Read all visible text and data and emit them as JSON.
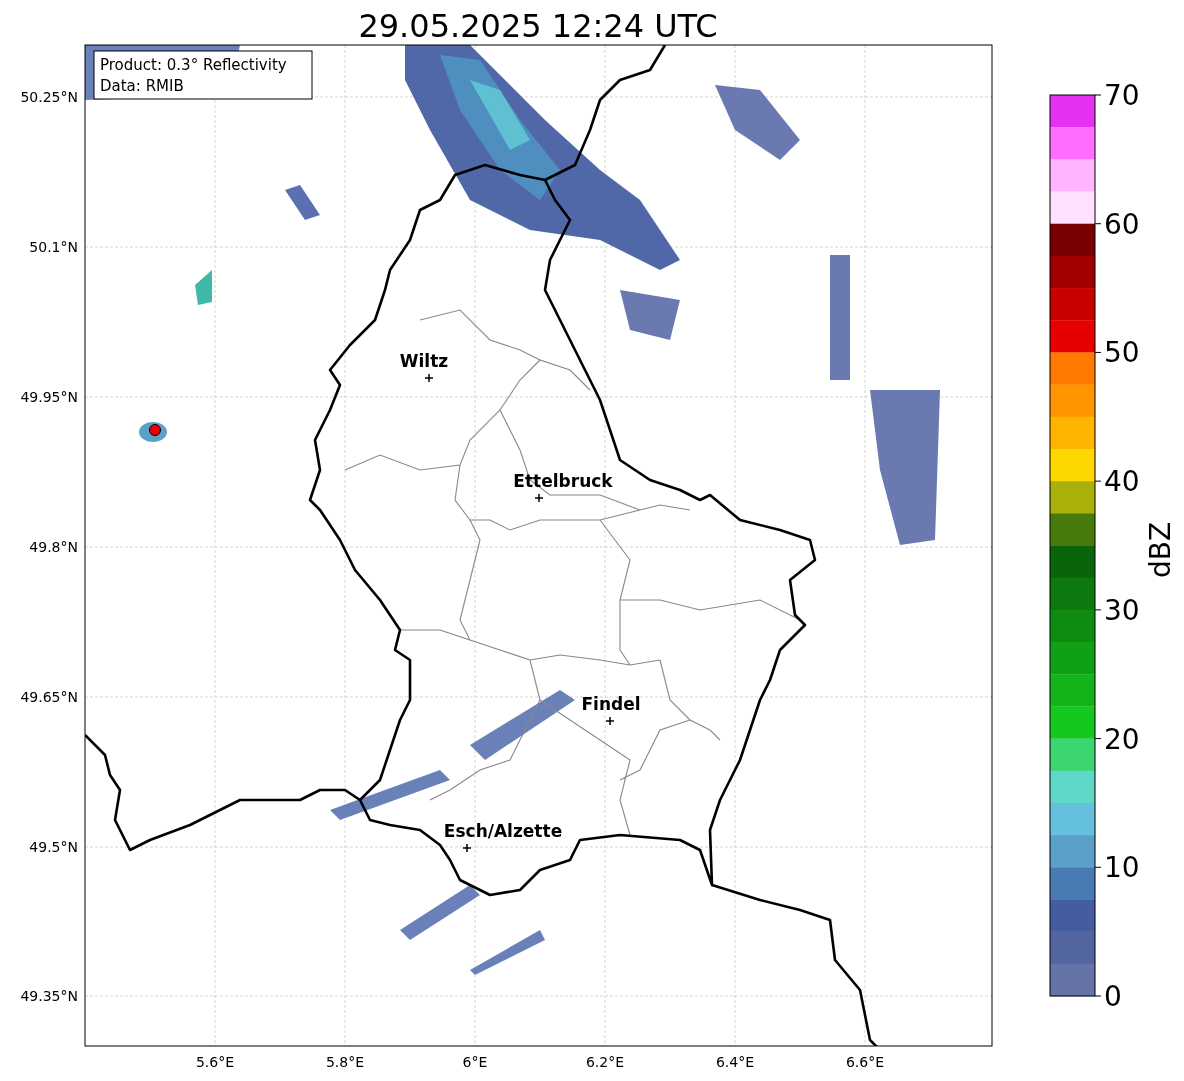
{
  "title": "29.05.2025 12:24 UTC",
  "info": [
    "Product: 0.3° Reflectivity",
    "Data: RMIB"
  ],
  "map": {
    "x_ticks": [
      "5.6°E",
      "5.8°E",
      "6°E",
      "6.2°E",
      "6.4°E",
      "6.6°E"
    ],
    "y_ticks": [
      "50.25°N",
      "50.1°N",
      "49.95°N",
      "49.8°N",
      "49.65°N",
      "49.5°N",
      "49.35°N"
    ],
    "cities": [
      {
        "name": "Wiltz"
      },
      {
        "name": "Ettelbruck"
      },
      {
        "name": "Findel"
      },
      {
        "name": "Esch/Alzette"
      }
    ]
  },
  "colorbar": {
    "label": "dBZ",
    "ticks": [
      "70",
      "60",
      "50",
      "40",
      "30",
      "20",
      "10",
      "0"
    ],
    "bins": [
      {
        "color": "#e632f0"
      },
      {
        "color": "#ff6eff"
      },
      {
        "color": "#ffb4ff"
      },
      {
        "color": "#ffe0ff"
      },
      {
        "color": "#780000"
      },
      {
        "color": "#a00000"
      },
      {
        "color": "#c80000"
      },
      {
        "color": "#e60000"
      },
      {
        "color": "#ff7800"
      },
      {
        "color": "#ff9600"
      },
      {
        "color": "#ffb400"
      },
      {
        "color": "#ffd700"
      },
      {
        "color": "#aab00a"
      },
      {
        "color": "#467a0a"
      },
      {
        "color": "#0a640c"
      },
      {
        "color": "#0c780e"
      },
      {
        "color": "#0e8c12"
      },
      {
        "color": "#10a016"
      },
      {
        "color": "#12b41a"
      },
      {
        "color": "#14c81e"
      },
      {
        "color": "#3cd670"
      },
      {
        "color": "#60d8c8"
      },
      {
        "color": "#64c0dc"
      },
      {
        "color": "#5aa0c8"
      },
      {
        "color": "#4a7ab4"
      },
      {
        "color": "#445ca0"
      },
      {
        "color": "#52659e"
      },
      {
        "color": "#6673a6"
      }
    ]
  }
}
